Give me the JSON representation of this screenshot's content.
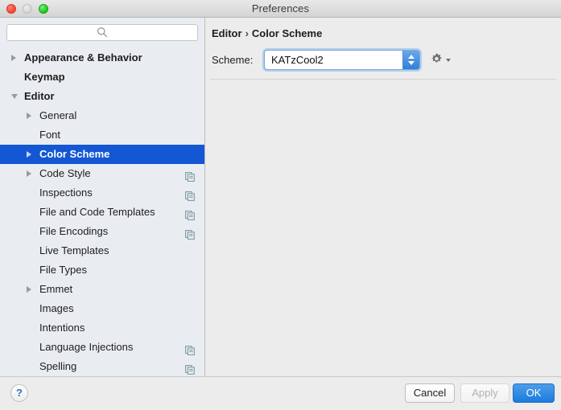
{
  "window": {
    "title": "Preferences",
    "traffic_lights": [
      "close-button",
      "minimize-button",
      "maximize-button"
    ]
  },
  "colors": {
    "selection_blue": "#1357d4",
    "accent_blue": "#1a7bdd",
    "sidebar_bg": "#e9edf1",
    "content_bg": "#ececec",
    "badge": "#7f9aa2"
  },
  "search": {
    "value": "",
    "placeholder": "",
    "icon": "search-icon"
  },
  "sidebar": {
    "items": [
      {
        "label": "Appearance & Behavior",
        "level": 0,
        "twisty": "collapsed",
        "badge": false,
        "selected": false
      },
      {
        "label": "Keymap",
        "level": 0,
        "twisty": "none",
        "badge": false,
        "selected": false
      },
      {
        "label": "Editor",
        "level": 0,
        "twisty": "expanded",
        "badge": false,
        "selected": false
      },
      {
        "label": "General",
        "level": 1,
        "twisty": "collapsed",
        "badge": false,
        "selected": false
      },
      {
        "label": "Font",
        "level": 1,
        "twisty": "none",
        "badge": false,
        "selected": false
      },
      {
        "label": "Color Scheme",
        "level": 1,
        "twisty": "collapsed",
        "badge": false,
        "selected": true
      },
      {
        "label": "Code Style",
        "level": 1,
        "twisty": "collapsed",
        "badge": true,
        "selected": false
      },
      {
        "label": "Inspections",
        "level": 1,
        "twisty": "none",
        "badge": true,
        "selected": false
      },
      {
        "label": "File and Code Templates",
        "level": 1,
        "twisty": "none",
        "badge": true,
        "selected": false
      },
      {
        "label": "File Encodings",
        "level": 1,
        "twisty": "none",
        "badge": true,
        "selected": false
      },
      {
        "label": "Live Templates",
        "level": 1,
        "twisty": "none",
        "badge": false,
        "selected": false
      },
      {
        "label": "File Types",
        "level": 1,
        "twisty": "none",
        "badge": false,
        "selected": false
      },
      {
        "label": "Emmet",
        "level": 1,
        "twisty": "collapsed",
        "badge": false,
        "selected": false
      },
      {
        "label": "Images",
        "level": 1,
        "twisty": "none",
        "badge": false,
        "selected": false
      },
      {
        "label": "Intentions",
        "level": 1,
        "twisty": "none",
        "badge": false,
        "selected": false
      },
      {
        "label": "Language Injections",
        "level": 1,
        "twisty": "none",
        "badge": true,
        "selected": false
      },
      {
        "label": "Spelling",
        "level": 1,
        "twisty": "none",
        "badge": true,
        "selected": false
      }
    ]
  },
  "content": {
    "breadcrumb": {
      "parent": "Editor",
      "separator": "›",
      "current": "Color Scheme"
    },
    "scheme": {
      "label": "Scheme:",
      "value": "KATzCool2",
      "options": [
        "KATzCool2"
      ],
      "gear_icon": "gear-icon"
    }
  },
  "footer": {
    "help_label": "?",
    "cancel_label": "Cancel",
    "apply_label": "Apply",
    "ok_label": "OK"
  }
}
